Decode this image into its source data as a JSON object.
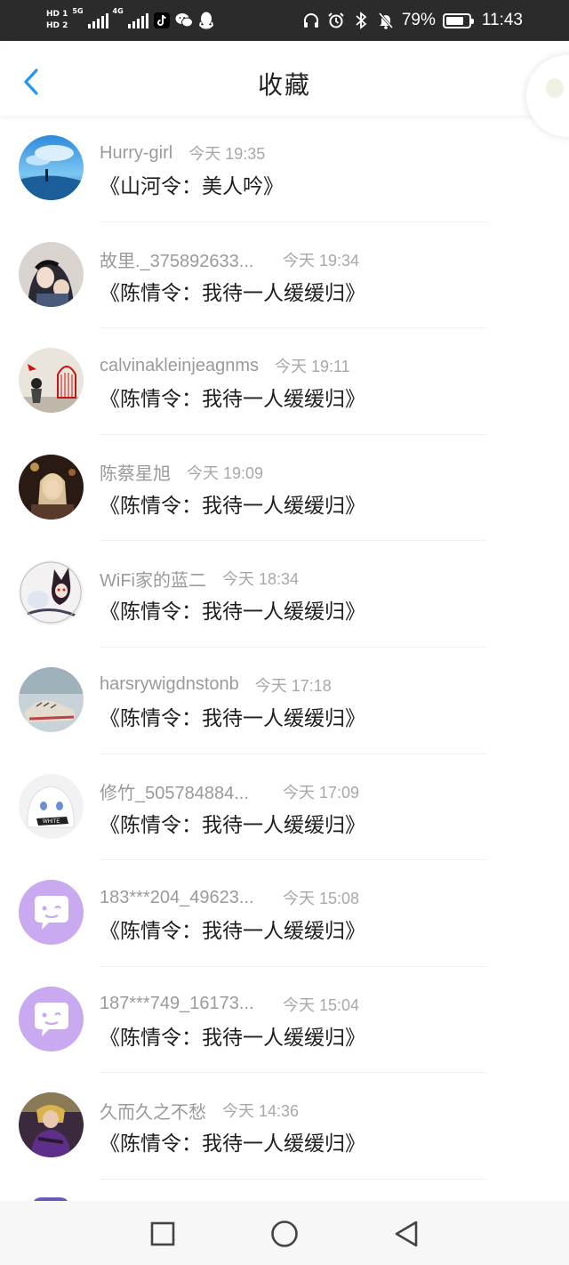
{
  "status_bar": {
    "hd1": "HD 1",
    "hd2": "HD 2",
    "net1": "5G",
    "net2": "4G",
    "apps": [
      "tiktok-icon",
      "wechat-icon",
      "qq-icon"
    ],
    "system_icons": [
      "headphones-icon",
      "alarm-icon",
      "bluetooth-icon",
      "mute-bell-icon"
    ],
    "battery_level": 0.79,
    "battery_percent": "79%",
    "time": "11:43"
  },
  "header": {
    "title": "收藏",
    "back_icon": "chevron-left-icon",
    "accent_color": "#2196f3"
  },
  "favorites": [
    {
      "username": "Hurry-girl",
      "time": "今天 19:35",
      "content": "《山河令：美人吟》",
      "avatar": "photo-sky"
    },
    {
      "username": "故里._375892633...",
      "time": "今天 19:34",
      "content": "《陈情令：我待一人缓缓归》",
      "avatar": "photo-anime-dark"
    },
    {
      "username": "calvinakleinjeagnms",
      "time": "今天 19:11",
      "content": "《陈情令：我待一人缓缓归》",
      "avatar": "photo-birdcage"
    },
    {
      "username": "陈蔡星旭",
      "time": "今天 19:09",
      "content": "《陈情令：我待一人缓缓归》",
      "avatar": "photo-girl-night"
    },
    {
      "username": "WiFi家的蓝二",
      "time": "今天 18:34",
      "content": "《陈情令：我待一人缓缓归》",
      "avatar": "photo-anime-cat"
    },
    {
      "username": "harsrywigdnstonb",
      "time": "今天 17:18",
      "content": "《陈情令：我待一人缓缓归》",
      "avatar": "photo-sneakers"
    },
    {
      "username": "修竹_505784884...",
      "time": "今天 17:09",
      "content": "《陈情令：我待一人缓缓归》",
      "avatar": "photo-anime-white"
    },
    {
      "username": "183***204_49623...",
      "time": "今天 15:08",
      "content": "《陈情令：我待一人缓缓归》",
      "avatar": "default-chat-avatar"
    },
    {
      "username": "187***749_16173...",
      "time": "今天 15:04",
      "content": "《陈情令：我待一人缓缓归》",
      "avatar": "default-chat-avatar"
    },
    {
      "username": "久而久之不愁",
      "time": "今天 14:36",
      "content": "《陈情令：我待一人缓缓归》",
      "avatar": "photo-girl-purple"
    }
  ],
  "nav_bar": {
    "buttons": [
      "recents-square-icon",
      "home-circle-icon",
      "back-triangle-icon"
    ]
  },
  "colors": {
    "status_bar_bg": "#2b2b2b",
    "default_avatar_bg": "#c9a9f0",
    "username_gray": "#9a9a9a",
    "content_text": "#1e1e1e"
  }
}
